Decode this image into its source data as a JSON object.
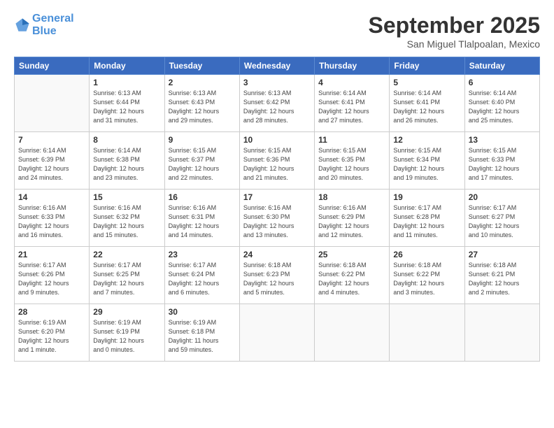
{
  "header": {
    "logo_line1": "General",
    "logo_line2": "Blue",
    "month": "September 2025",
    "location": "San Miguel Tlalpoalan, Mexico"
  },
  "weekdays": [
    "Sunday",
    "Monday",
    "Tuesday",
    "Wednesday",
    "Thursday",
    "Friday",
    "Saturday"
  ],
  "weeks": [
    [
      {
        "day": "",
        "info": ""
      },
      {
        "day": "1",
        "info": "Sunrise: 6:13 AM\nSunset: 6:44 PM\nDaylight: 12 hours\nand 31 minutes."
      },
      {
        "day": "2",
        "info": "Sunrise: 6:13 AM\nSunset: 6:43 PM\nDaylight: 12 hours\nand 29 minutes."
      },
      {
        "day": "3",
        "info": "Sunrise: 6:13 AM\nSunset: 6:42 PM\nDaylight: 12 hours\nand 28 minutes."
      },
      {
        "day": "4",
        "info": "Sunrise: 6:14 AM\nSunset: 6:41 PM\nDaylight: 12 hours\nand 27 minutes."
      },
      {
        "day": "5",
        "info": "Sunrise: 6:14 AM\nSunset: 6:41 PM\nDaylight: 12 hours\nand 26 minutes."
      },
      {
        "day": "6",
        "info": "Sunrise: 6:14 AM\nSunset: 6:40 PM\nDaylight: 12 hours\nand 25 minutes."
      }
    ],
    [
      {
        "day": "7",
        "info": "Sunrise: 6:14 AM\nSunset: 6:39 PM\nDaylight: 12 hours\nand 24 minutes."
      },
      {
        "day": "8",
        "info": "Sunrise: 6:14 AM\nSunset: 6:38 PM\nDaylight: 12 hours\nand 23 minutes."
      },
      {
        "day": "9",
        "info": "Sunrise: 6:15 AM\nSunset: 6:37 PM\nDaylight: 12 hours\nand 22 minutes."
      },
      {
        "day": "10",
        "info": "Sunrise: 6:15 AM\nSunset: 6:36 PM\nDaylight: 12 hours\nand 21 minutes."
      },
      {
        "day": "11",
        "info": "Sunrise: 6:15 AM\nSunset: 6:35 PM\nDaylight: 12 hours\nand 20 minutes."
      },
      {
        "day": "12",
        "info": "Sunrise: 6:15 AM\nSunset: 6:34 PM\nDaylight: 12 hours\nand 19 minutes."
      },
      {
        "day": "13",
        "info": "Sunrise: 6:15 AM\nSunset: 6:33 PM\nDaylight: 12 hours\nand 17 minutes."
      }
    ],
    [
      {
        "day": "14",
        "info": "Sunrise: 6:16 AM\nSunset: 6:33 PM\nDaylight: 12 hours\nand 16 minutes."
      },
      {
        "day": "15",
        "info": "Sunrise: 6:16 AM\nSunset: 6:32 PM\nDaylight: 12 hours\nand 15 minutes."
      },
      {
        "day": "16",
        "info": "Sunrise: 6:16 AM\nSunset: 6:31 PM\nDaylight: 12 hours\nand 14 minutes."
      },
      {
        "day": "17",
        "info": "Sunrise: 6:16 AM\nSunset: 6:30 PM\nDaylight: 12 hours\nand 13 minutes."
      },
      {
        "day": "18",
        "info": "Sunrise: 6:16 AM\nSunset: 6:29 PM\nDaylight: 12 hours\nand 12 minutes."
      },
      {
        "day": "19",
        "info": "Sunrise: 6:17 AM\nSunset: 6:28 PM\nDaylight: 12 hours\nand 11 minutes."
      },
      {
        "day": "20",
        "info": "Sunrise: 6:17 AM\nSunset: 6:27 PM\nDaylight: 12 hours\nand 10 minutes."
      }
    ],
    [
      {
        "day": "21",
        "info": "Sunrise: 6:17 AM\nSunset: 6:26 PM\nDaylight: 12 hours\nand 9 minutes."
      },
      {
        "day": "22",
        "info": "Sunrise: 6:17 AM\nSunset: 6:25 PM\nDaylight: 12 hours\nand 7 minutes."
      },
      {
        "day": "23",
        "info": "Sunrise: 6:17 AM\nSunset: 6:24 PM\nDaylight: 12 hours\nand 6 minutes."
      },
      {
        "day": "24",
        "info": "Sunrise: 6:18 AM\nSunset: 6:23 PM\nDaylight: 12 hours\nand 5 minutes."
      },
      {
        "day": "25",
        "info": "Sunrise: 6:18 AM\nSunset: 6:22 PM\nDaylight: 12 hours\nand 4 minutes."
      },
      {
        "day": "26",
        "info": "Sunrise: 6:18 AM\nSunset: 6:22 PM\nDaylight: 12 hours\nand 3 minutes."
      },
      {
        "day": "27",
        "info": "Sunrise: 6:18 AM\nSunset: 6:21 PM\nDaylight: 12 hours\nand 2 minutes."
      }
    ],
    [
      {
        "day": "28",
        "info": "Sunrise: 6:19 AM\nSunset: 6:20 PM\nDaylight: 12 hours\nand 1 minute."
      },
      {
        "day": "29",
        "info": "Sunrise: 6:19 AM\nSunset: 6:19 PM\nDaylight: 12 hours\nand 0 minutes."
      },
      {
        "day": "30",
        "info": "Sunrise: 6:19 AM\nSunset: 6:18 PM\nDaylight: 11 hours\nand 59 minutes."
      },
      {
        "day": "",
        "info": ""
      },
      {
        "day": "",
        "info": ""
      },
      {
        "day": "",
        "info": ""
      },
      {
        "day": "",
        "info": ""
      }
    ]
  ]
}
